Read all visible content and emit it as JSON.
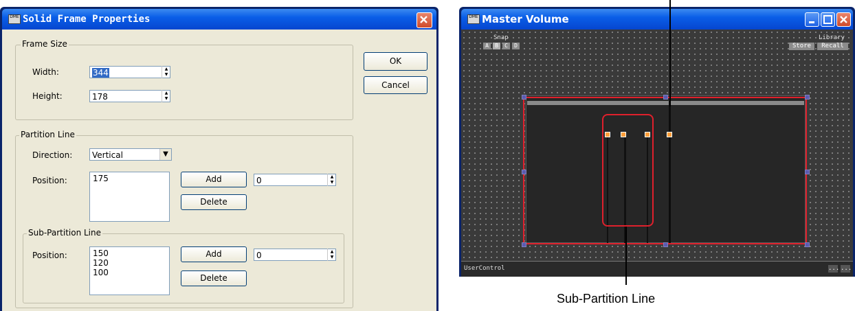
{
  "dialog": {
    "title": "Solid Frame Properties",
    "ok_label": "OK",
    "cancel_label": "Cancel",
    "frame_size": {
      "legend": "Frame Size",
      "width_label": "Width:",
      "width_value": "344",
      "height_label": "Height:",
      "height_value": "178"
    },
    "partition_line": {
      "legend": "Partition Line",
      "direction_label": "Direction:",
      "direction_value": "Vertical",
      "position_label": "Position:",
      "positions": [
        "175"
      ],
      "add_label": "Add",
      "delete_label": "Delete",
      "spin_value": "0"
    },
    "sub_partition_line": {
      "legend": "Sub-Partition Line",
      "position_label": "Position:",
      "positions": [
        "150",
        "120",
        "100"
      ],
      "add_label": "Add",
      "delete_label": "Delete",
      "spin_value": "0"
    }
  },
  "master_volume": {
    "title": "Master Volume",
    "snap_label": "Snap",
    "snap_buttons": [
      "A",
      "B",
      "C",
      "D"
    ],
    "library_label": "Library",
    "store_label": "Store",
    "recall_label": "Recall",
    "status_text": "UserControl",
    "status_buttons": [
      "...",
      "..."
    ]
  },
  "callouts": {
    "sub_partition_line": "Sub-Partition Line"
  },
  "colors": {
    "titlebar": "#0a5ee8",
    "dialog_face": "#ece9d8",
    "canvas_bg": "#3a3a3a",
    "highlight_red": "#e0202c",
    "selection_blue": "#316ac5"
  }
}
